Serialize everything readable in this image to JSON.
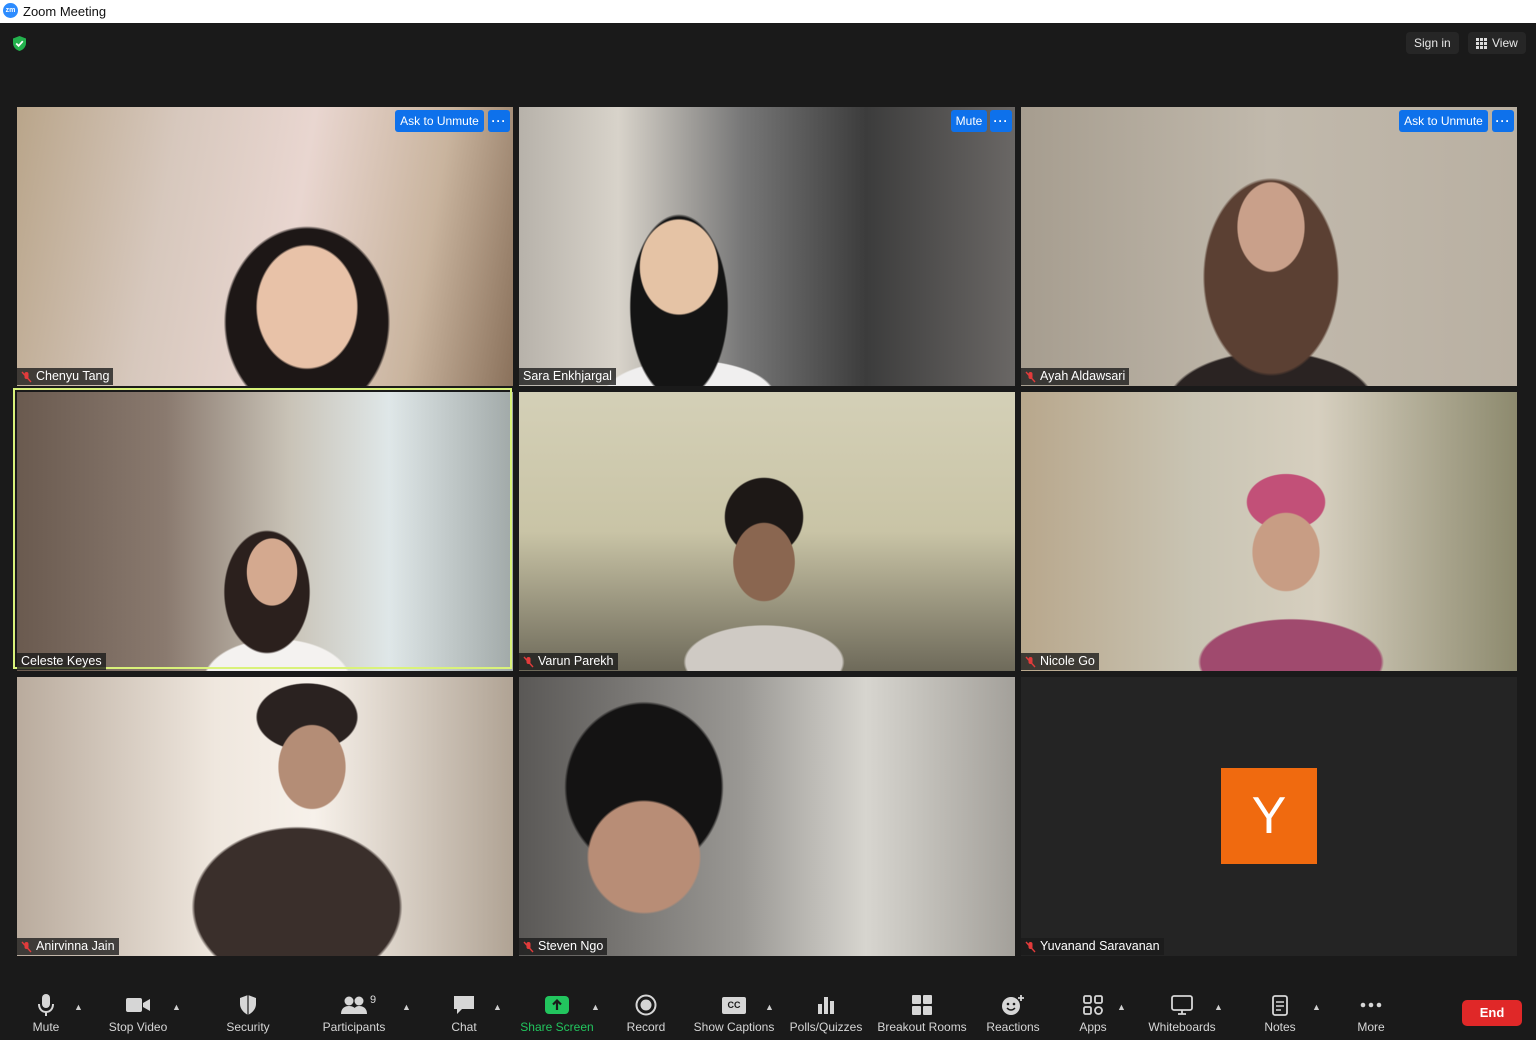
{
  "window": {
    "title": "Zoom Meeting"
  },
  "top_controls": {
    "sign_in": "Sign in",
    "view": "View"
  },
  "tiles": [
    {
      "name": "Chenyu Tang",
      "muted": true,
      "action": "Ask to Unmute"
    },
    {
      "name": "Sara Enkhjargal",
      "muted": false,
      "action": "Mute"
    },
    {
      "name": "Ayah Aldawsari",
      "muted": true,
      "action": "Ask to Unmute"
    },
    {
      "name": "Celeste Keyes",
      "muted": false,
      "active_speaker": true
    },
    {
      "name": "Varun Parekh",
      "muted": true
    },
    {
      "name": "Nicole Go",
      "muted": true
    },
    {
      "name": "Anirvinna Jain",
      "muted": true
    },
    {
      "name": "Steven Ngo",
      "muted": true
    },
    {
      "name": "Yuvanand Saravanan",
      "muted": true,
      "avatar_letter": "Y",
      "video_off": true
    }
  ],
  "more_dots": "···",
  "toolbar": {
    "mute": "Mute",
    "stop_video": "Stop Video",
    "security": "Security",
    "participants": "Participants",
    "participants_count": "9",
    "chat": "Chat",
    "share_screen": "Share Screen",
    "record": "Record",
    "show_captions": "Show Captions",
    "captions_icon": "CC",
    "polls": "Polls/Quizzes",
    "breakout": "Breakout Rooms",
    "reactions": "Reactions",
    "apps": "Apps",
    "whiteboards": "Whiteboards",
    "notes": "Notes",
    "more": "More",
    "end": "End"
  },
  "colors": {
    "accent": "#0e71eb",
    "end": "#E02828",
    "share": "#22c55e",
    "avatar": "#F06A0F",
    "speaker_frame": "#d9f27a"
  }
}
